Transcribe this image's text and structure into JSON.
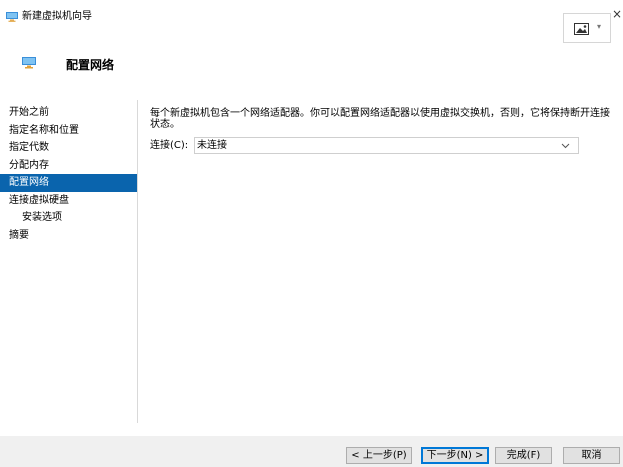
{
  "window": {
    "title": "新建虚拟机向导",
    "close_glyph": "×"
  },
  "header": {
    "title": "配置网络"
  },
  "nav": {
    "items": [
      {
        "label": "开始之前"
      },
      {
        "label": "指定名称和位置"
      },
      {
        "label": "指定代数"
      },
      {
        "label": "分配内存"
      },
      {
        "label": "配置网络",
        "selected": true
      },
      {
        "label": "连接虚拟硬盘"
      },
      {
        "label": "安装选项",
        "sub": true
      },
      {
        "label": "摘要"
      }
    ]
  },
  "content": {
    "description": "每个新虚拟机包含一个网络适配器。你可以配置网络适配器以使用虚拟交换机，否则，它将保持断开连接状态。",
    "connection_label": "连接(C):",
    "connection_value": "未连接"
  },
  "buttons": {
    "prev": "< 上一步(P)",
    "next": "下一步(N) >",
    "finish": "完成(F)",
    "cancel": "取消"
  },
  "icons": {
    "title": "monitor-icon",
    "header": "monitor-icon",
    "tool": "picture-icon",
    "dropdown": "chevron-down-icon"
  },
  "colors": {
    "accent": "#0a64ad",
    "primary_border": "#0078d7",
    "footer_bg": "#f0f0f0"
  }
}
